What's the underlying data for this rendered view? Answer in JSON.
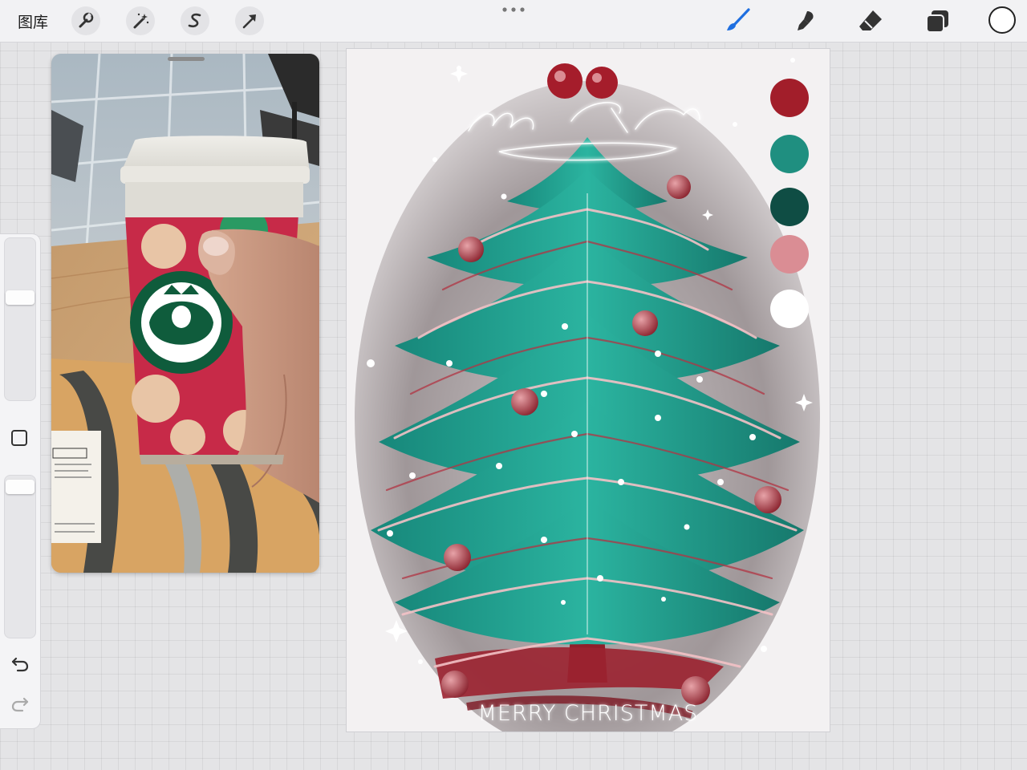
{
  "toolbar": {
    "gallery_label": "图库",
    "left_tools": [
      {
        "name": "actions-wrench-icon"
      },
      {
        "name": "adjustments-magic-wand-icon"
      },
      {
        "name": "selection-s-icon"
      },
      {
        "name": "transform-arrow-icon"
      }
    ],
    "right_tools": [
      {
        "name": "paint-brush-icon",
        "active": true,
        "color": "#1f6fe0"
      },
      {
        "name": "smudge-icon"
      },
      {
        "name": "eraser-icon"
      },
      {
        "name": "layers-icon"
      }
    ],
    "current_color": "#ffffff"
  },
  "sidebar": {
    "brush_size_slider": 0.8,
    "opacity_slider": 1.0
  },
  "reference_window": {
    "content": "reference-photo-coffee-cup"
  },
  "canvas": {
    "artwork": {
      "script_title": "Merry Christmas",
      "bottom_text": "MERRY CHRISTMAS"
    },
    "palette": [
      {
        "name": "red",
        "color": "#a21e2a"
      },
      {
        "name": "teal",
        "color": "#1f8f80"
      },
      {
        "name": "dark-green",
        "color": "#0f4d44"
      },
      {
        "name": "pink",
        "color": "#da8d94"
      },
      {
        "name": "white",
        "color": "#ffffff"
      }
    ]
  },
  "colors": {
    "accent": "#1f6fe0",
    "red": "#a21e2a",
    "teal": "#1f8f80",
    "pink": "#f0b3b8"
  }
}
